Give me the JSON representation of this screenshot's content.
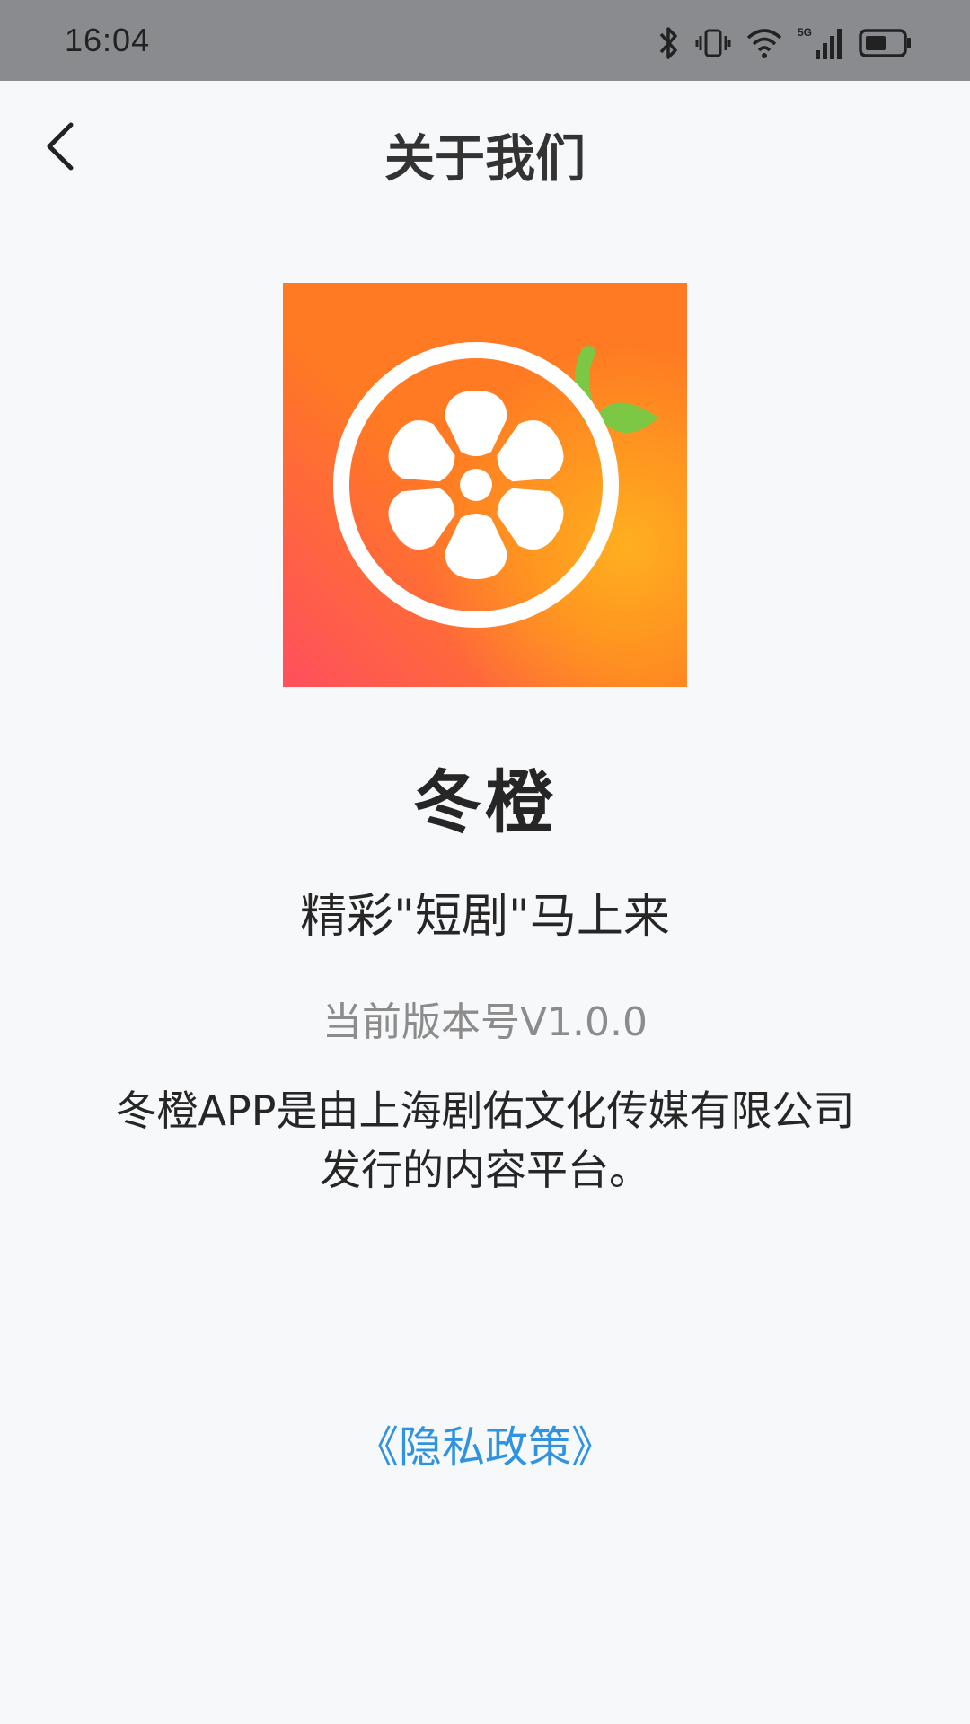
{
  "status_bar": {
    "time": "16:04",
    "icons": [
      "bluetooth-icon",
      "vibrate-icon",
      "wifi-icon",
      "signal-5g-icon",
      "battery-icon"
    ]
  },
  "nav": {
    "title": "关于我们",
    "back_icon": "chevron-left-icon"
  },
  "app": {
    "logo_icon": "orange-film-reel-logo",
    "name": "冬橙",
    "slogan": "精彩\"短剧\"马上来",
    "version": "当前版本号V1.0.0",
    "description": "冬橙APP是由上海剧佑文化传媒有限公司发行的内容平台。"
  },
  "links": {
    "privacy": "《隐私政策》"
  },
  "colors": {
    "status_bar": "#8a8b8e",
    "background": "#f7f8fa",
    "link": "#2f93e0",
    "logo_orange": "#ff7a22",
    "logo_red": "#ff4f5e",
    "logo_yellow": "#ffb21f",
    "leaf_green": "#7cc743"
  }
}
